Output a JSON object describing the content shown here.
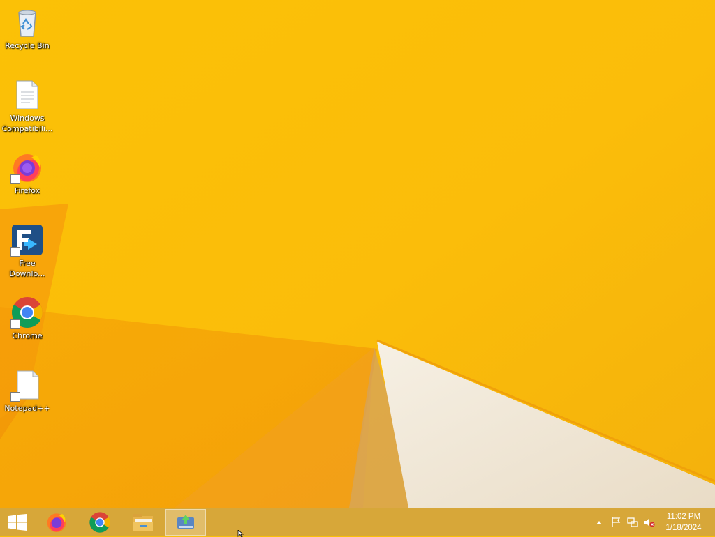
{
  "theme": {
    "wallpaper_accent": "#f9bf0a",
    "taskbar_color": "#cda046"
  },
  "desktop": {
    "icons": [
      {
        "label": "Recycle Bin",
        "icon": "recycle-bin-icon"
      },
      {
        "label": "Windows\nCompatibili...",
        "icon": "document-icon"
      },
      {
        "label": "Firefox",
        "icon": "firefox-icon"
      },
      {
        "label": "Free\nDownlo...",
        "icon": "free-download-manager-icon"
      },
      {
        "label": "Chrome",
        "icon": "chrome-icon"
      },
      {
        "label": "Notepad++",
        "icon": "notepadpp-icon"
      }
    ]
  },
  "taskbar": {
    "start": "windows-start-icon",
    "pinned": [
      "firefox-icon",
      "chrome-icon",
      "file-explorer-icon",
      "free-download-manager-icon"
    ],
    "active_index": 3,
    "tray": {
      "icons": [
        "show-hidden-icons-chevron-icon",
        "action-center-flag-icon",
        "network-icon",
        "volume-muted-icon"
      ],
      "time": "11:02 PM",
      "date": "1/18/2024"
    }
  }
}
